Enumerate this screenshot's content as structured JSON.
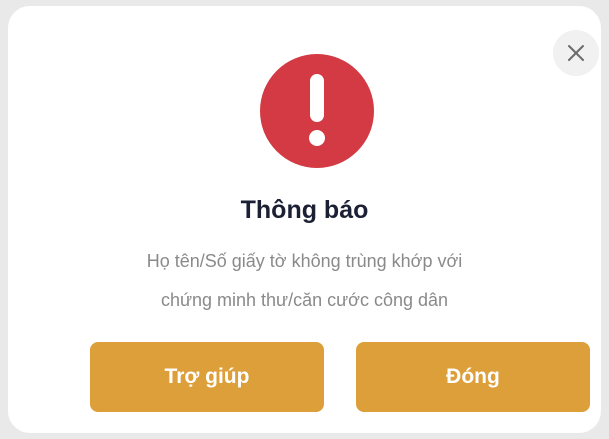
{
  "dialog": {
    "title": "Thông báo",
    "message_line1": "Họ tên/Số giấy tờ không trùng khớp với",
    "message_line2": "chứng minh thư/căn cước công dân",
    "help_button_label": "Trợ giúp",
    "close_button_label": "Đóng",
    "alert_icon": "exclamation-icon",
    "close_icon": "close-icon"
  },
  "colors": {
    "alert_red": "#d33a43",
    "button_orange": "#dc9f3a",
    "title_color": "#1b2034",
    "message_color": "#8a8a8a"
  }
}
